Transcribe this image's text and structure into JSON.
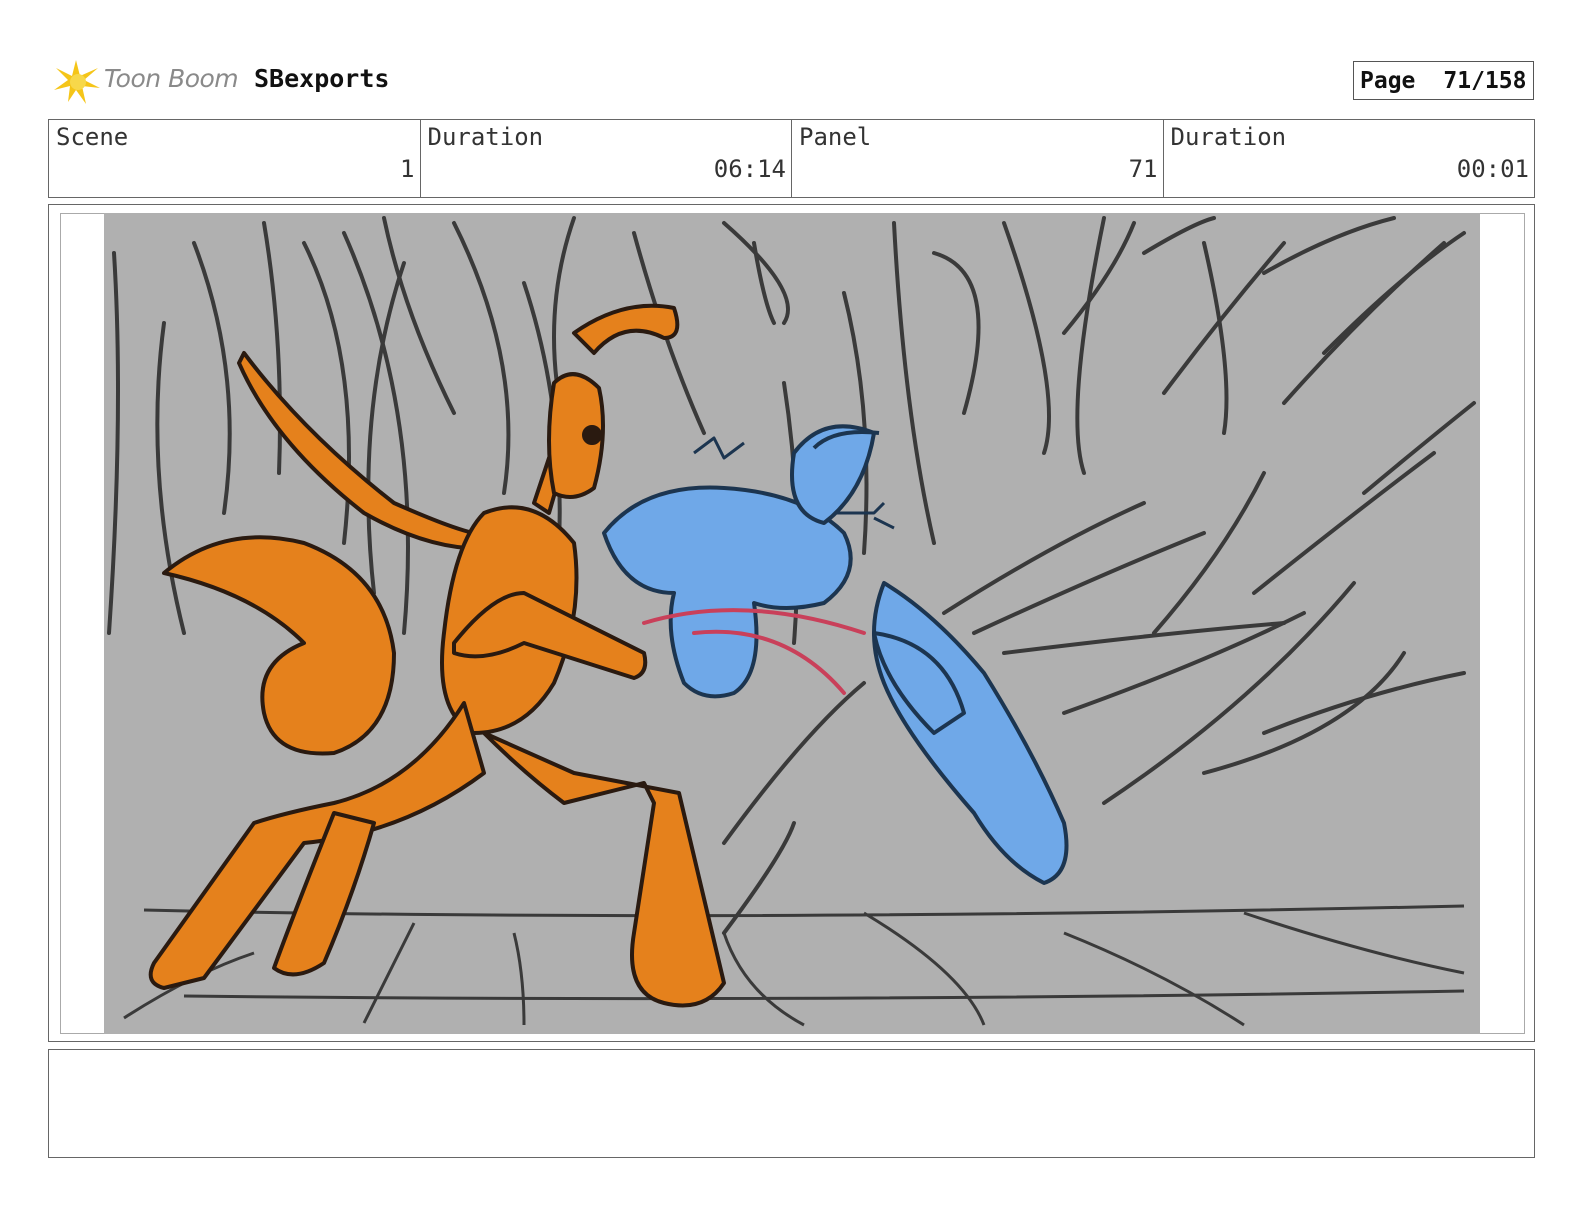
{
  "header": {
    "logo_text": "Toon Boom",
    "project_name": "SBexports",
    "page_label": "Page",
    "page_number": "71/158"
  },
  "info": {
    "scene_label": "Scene",
    "scene_value": "1",
    "scene_duration_label": "Duration",
    "scene_duration_value": "06:14",
    "panel_label": "Panel",
    "panel_value": "71",
    "panel_duration_label": "Duration",
    "panel_duration_value": "00:01"
  },
  "colors": {
    "background_gray": "#b0b0b0",
    "orange_character": "#e5811c",
    "blue_character": "#6fa8e8",
    "impact_line": "#c9405a",
    "logo_yellow": "#f5c518"
  },
  "notes": {
    "text": ""
  }
}
